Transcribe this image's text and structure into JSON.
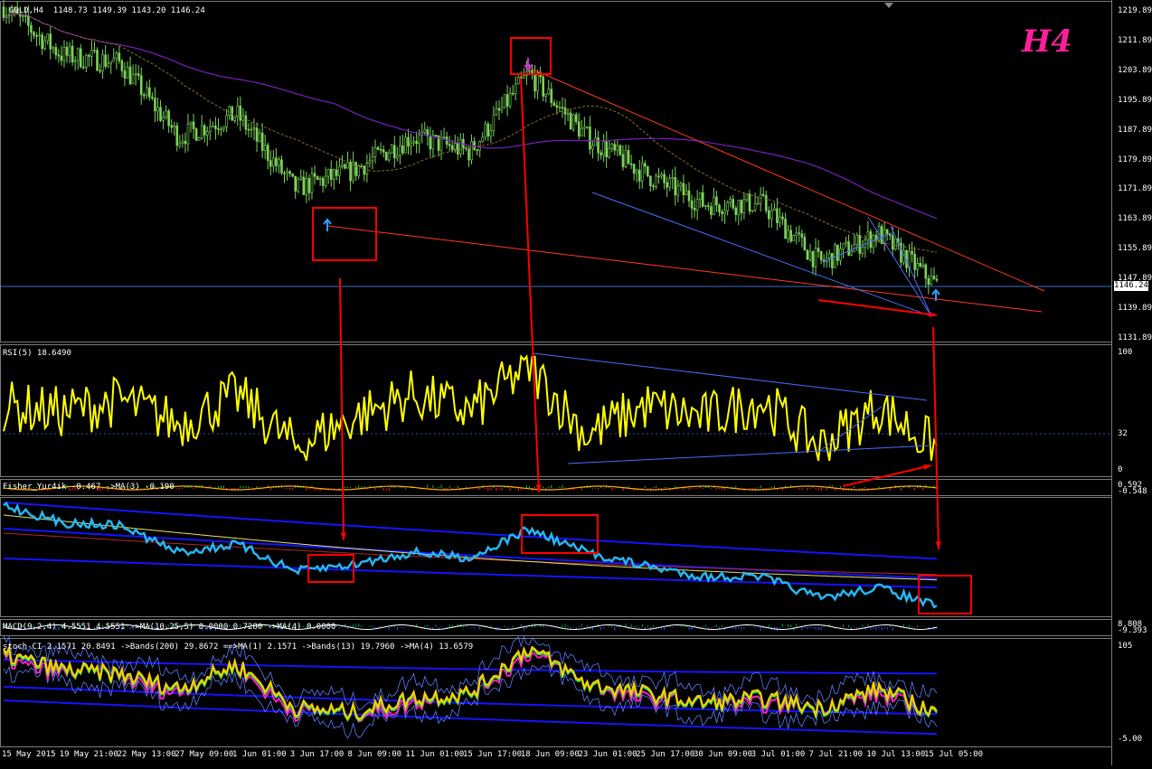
{
  "window": {
    "symbol_header": "GOLD,H4",
    "ohlc": "1148.73 1149.39 1143.20 1146.24",
    "timeframe_badge": "H4",
    "current_price": "1146.24"
  },
  "price_axis": [
    "1219.89",
    "1211.89",
    "1203.89",
    "1195.89",
    "1187.89",
    "1179.89",
    "1171.89",
    "1163.89",
    "1155.89",
    "1147.89",
    "1139.89",
    "1131.89"
  ],
  "rsi_panel": {
    "label": "RSI(5) 18.6490",
    "levels": [
      "100",
      "32",
      "0"
    ]
  },
  "fisher_panel": {
    "label": "Fisher_Yur4ik -0.467  ->MA(3) -0.190",
    "levels": [
      "0.592",
      "-0.548"
    ]
  },
  "macd_panel": {
    "label": "MACD(9,2,4) 4.5551 4.5551  ->MA(10,25,5) 0.0000  0.7280  ->MA(4) 0.0000",
    "levels": [
      "8.808",
      "-9.393"
    ]
  },
  "stoch_panel": {
    "label": "stoch-CI 2.1571 20.8491  ->Bands(200) 29.8672  ==>MA(1) 2.1571  ->Bands(13) 19.7960  ->MA(4) 13.6579",
    "levels": [
      "105",
      "-5.00"
    ]
  },
  "time_axis": [
    "15 May 2015",
    "19 May 21:00",
    "22 May 13:00",
    "27 May 09:00",
    "1 Jun 01:00",
    "3 Jun 17:00",
    "8 Jun 09:00",
    "11 Jun 01:00",
    "15 Jun 17:00",
    "18 Jun 09:00",
    "23 Jun 01:00",
    "25 Jun 17:00",
    "30 Jun 09:00",
    "3 Jul 01:00",
    "7 Jul 21:00",
    "10 Jul 13:00",
    "15 Jul 05:00"
  ],
  "colors": {
    "candles": "#7cd35a",
    "rsi": "#ffff00",
    "cci": "#27b6f2",
    "bands": "#1414ff",
    "trendline": "#ff3b1f",
    "channel": "#4a6cff",
    "annotation": "#ff0000",
    "badge": "#ff1f9a"
  },
  "chart_data": {
    "type": "line",
    "title": "GOLD,H4",
    "x": [
      "15 May 2015",
      "19 May 21:00",
      "22 May 13:00",
      "27 May 09:00",
      "1 Jun 01:00",
      "3 Jun 17:00",
      "8 Jun 09:00",
      "11 Jun 01:00",
      "15 Jun 17:00",
      "18 Jun 09:00",
      "23 Jun 01:00",
      "25 Jun 17:00",
      "30 Jun 09:00",
      "3 Jul 01:00",
      "7 Jul 21:00",
      "10 Jul 13:00",
      "15 Jul 05:00"
    ],
    "series": [
      {
        "name": "GOLD,H4",
        "values": [
          1221,
          1208,
          1206,
          1186,
          1192,
          1172,
          1177,
          1186,
          1182,
          1203,
          1186,
          1176,
          1168,
          1168,
          1152,
          1160,
          1146
        ]
      },
      {
        "name": "RSI(5)",
        "values": [
          55,
          50,
          60,
          40,
          65,
          20,
          45,
          65,
          50,
          90,
          30,
          55,
          45,
          60,
          20,
          55,
          18.6
        ]
      }
    ],
    "ylim": [
      1131.89,
      1219.89
    ]
  }
}
